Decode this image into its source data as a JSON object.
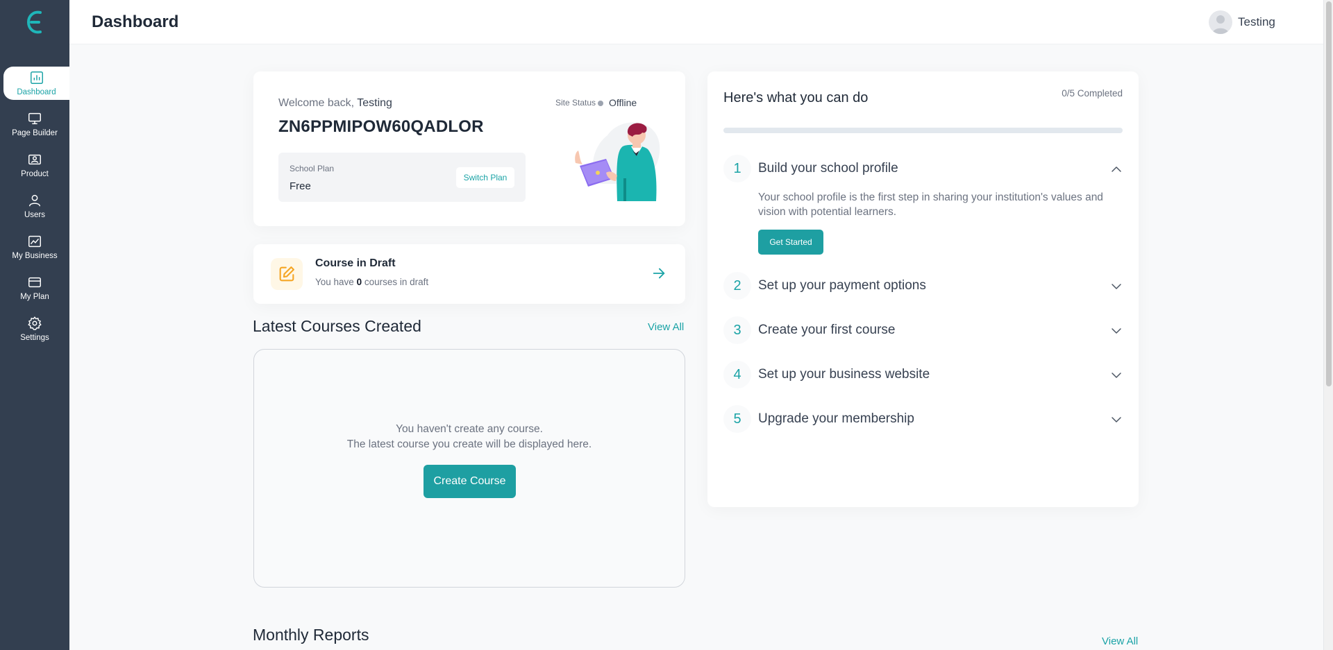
{
  "header": {
    "title": "Dashboard",
    "user_name": "Testing"
  },
  "sidebar": {
    "items": [
      {
        "label": "Dashboard",
        "icon": "chart-icon",
        "active": true
      },
      {
        "label": "Page Builder",
        "icon": "monitor-icon"
      },
      {
        "label": "Product",
        "icon": "product-icon"
      },
      {
        "label": "Users",
        "icon": "user-icon"
      },
      {
        "label": "My Business",
        "icon": "trend-icon"
      },
      {
        "label": "My Plan",
        "icon": "card-icon"
      },
      {
        "label": "Settings",
        "icon": "gear-icon"
      }
    ]
  },
  "welcome": {
    "greeting": "Welcome back,",
    "user": "Testing",
    "school_code": "ZN6PPMIPOW60QADLOR",
    "site_status_label": "Site Status",
    "site_status": "Offline",
    "plan_label": "School Plan",
    "plan_value": "Free",
    "switch_plan": "Switch Plan"
  },
  "draft": {
    "title": "Course in Draft",
    "sub_prefix": "You have",
    "count": "0",
    "sub_suffix": "courses in draft"
  },
  "latest_courses": {
    "title": "Latest Courses Created",
    "view_all": "View All",
    "empty_line1": "You haven't create any course.",
    "empty_line2": "The latest course you create will be displayed here.",
    "create_button": "Create Course"
  },
  "monthly_reports": {
    "title": "Monthly Reports",
    "view_all": "View All"
  },
  "todo": {
    "title": "Here's what you can do",
    "completed": "0/5 Completed",
    "progress": 0,
    "steps": [
      {
        "num": "1",
        "title": "Build your school profile",
        "expanded": true
      },
      {
        "num": "2",
        "title": "Set up your payment options"
      },
      {
        "num": "3",
        "title": "Create your first course"
      },
      {
        "num": "4",
        "title": "Set up your business website"
      },
      {
        "num": "5",
        "title": "Upgrade your membership"
      }
    ],
    "step1_desc": "Your school profile is the first step in sharing your institution's values and vision with potential learners.",
    "get_started": "Get Started"
  },
  "colors": {
    "accent": "#1aa3a6",
    "sidebar": "#333f50"
  }
}
